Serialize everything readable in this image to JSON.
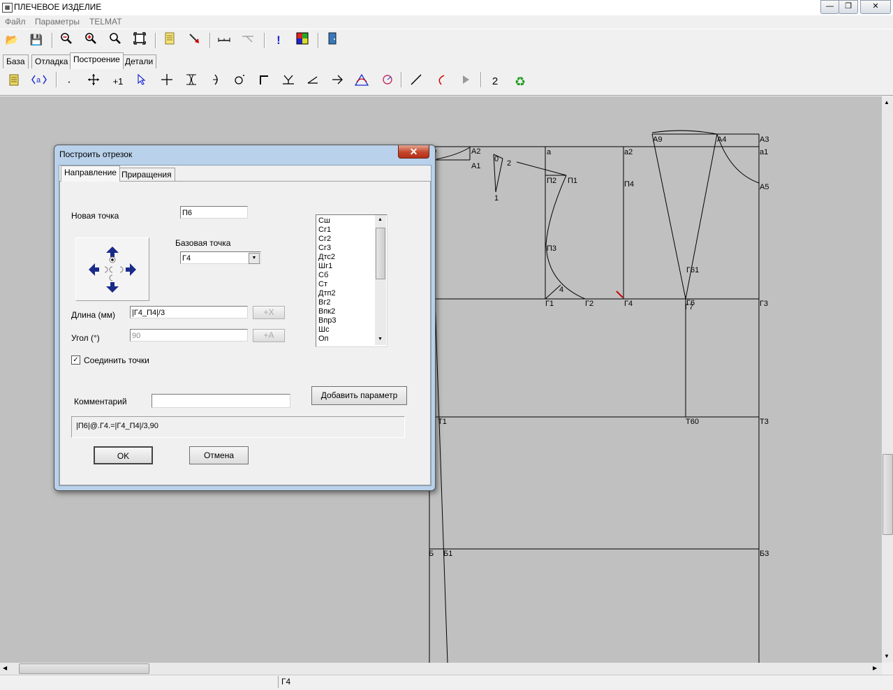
{
  "window": {
    "title": "ПЛЕЧЕВОЕ ИЗДЕЛИЕ",
    "min_glyph": "—",
    "max_glyph": "❐",
    "close_glyph": "✕"
  },
  "menu": [
    "Файл",
    "Параметры",
    "TELMAT"
  ],
  "main_tabs": [
    "База",
    "Отладка",
    "Построение",
    "Детали"
  ],
  "toolbar2_text": {
    "plus1": "+1",
    "two": "2"
  },
  "drawing": {
    "labels": [
      "А2",
      "А1",
      "0",
      "2",
      "1",
      "а",
      "П2",
      "П1",
      "П3",
      "4",
      "Г1",
      "Г2",
      "а2",
      "П4",
      "Г4",
      "А9",
      "А4",
      "А3",
      "а1",
      "А5",
      "Г61",
      "Г7",
      "Г6",
      "Г3",
      "Т1",
      "Т60",
      "Т3",
      "Б",
      "Б1",
      "Б3",
      "Г",
      "0"
    ]
  },
  "dialog": {
    "title": "Построить отрезок",
    "close_glyph": "✕",
    "tabs": [
      "Направление",
      "Приращения"
    ],
    "new_point_label": "Новая точка",
    "new_point_value": "П6",
    "base_point_label": "Базовая точка",
    "base_point_value": "Г4",
    "length_label": "Длина (мм)",
    "length_value": "|Г4_П4|/3",
    "angle_label": "Угол (°)",
    "angle_value": "90",
    "add_x_label": "+X",
    "add_a_label": "+A",
    "connect_label": "Соединить точки",
    "connect_checked": true,
    "comment_label": "Комментарий",
    "comment_value": "",
    "add_param_label": "Добавить параметр",
    "formula": "|П6|@.Г4.=|Г4_П4|/3,90",
    "ok_label": "OK",
    "cancel_label": "Отмена",
    "param_list": [
      "Сш",
      "Сг1",
      "Сг2",
      "Сг3",
      "Дтс2",
      "Шг1",
      "Сб",
      "Ст",
      "Дтп2",
      "Вг2",
      "Впк2",
      "Впр3",
      "Шс",
      "Оп"
    ]
  },
  "status": {
    "cell": "Г4"
  }
}
